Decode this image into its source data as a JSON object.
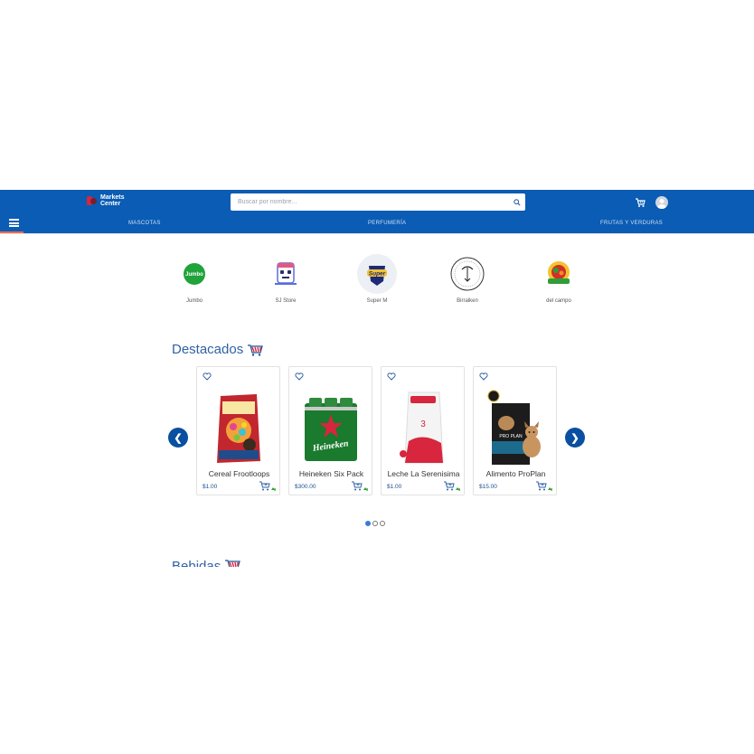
{
  "header": {
    "logo_line1": "Markets",
    "logo_line2": "Center",
    "search_placeholder": "Buscar por nombre..."
  },
  "nav": {
    "links": [
      "MASCOTAS",
      "PERFUMERÍA",
      "FRUTAS Y VERDURAS"
    ]
  },
  "stores": [
    {
      "name": "Jumbo",
      "logo_text": "Jumbo"
    },
    {
      "name": "SJ Store"
    },
    {
      "name": "Super M",
      "logo_text": "Super"
    },
    {
      "name": "Birralken"
    },
    {
      "name": "del campo"
    }
  ],
  "featured": {
    "title": "Destacados",
    "products": [
      {
        "name": "Cereal Frootloops",
        "price": "$1.00"
      },
      {
        "name": "Heineken Six Pack",
        "price": "$300.00",
        "label": "Heineken"
      },
      {
        "name": "Leche La Serenisima",
        "price": "$1.00"
      },
      {
        "name": "Alimento ProPlan",
        "price": "$15.00",
        "label": "PRO PLAN"
      }
    ],
    "prev_label": "❮",
    "next_label": "❯",
    "pages": 3,
    "active_page": 1
  },
  "next_section": {
    "title": "Bebidas"
  },
  "colors": {
    "header": "#0a5cb4",
    "accent": "#2f62a5",
    "arrow": "#0a4fa0",
    "cart_plus": "#2ca02c"
  }
}
